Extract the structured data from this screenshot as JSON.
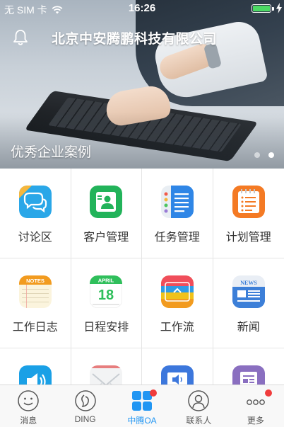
{
  "status_bar": {
    "carrier": "无 SIM 卡",
    "time": "16:26",
    "battery_level": 1.0
  },
  "header": {
    "company_name": "北京中安腾鹏科技有限公司",
    "bell_icon": "bell-icon"
  },
  "banner": {
    "caption": "优秀企业案例",
    "page_count": 2,
    "active_page": 2
  },
  "apps": [
    {
      "label": "讨论区",
      "icon": "chat-bubbles-icon",
      "color": "#2aa7e8"
    },
    {
      "label": "客户管理",
      "icon": "customer-card-icon",
      "color": "#22b35a"
    },
    {
      "label": "任务管理",
      "icon": "task-list-icon",
      "color": "#2f86e6"
    },
    {
      "label": "计划管理",
      "icon": "plan-notepad-icon",
      "color": "#f47a24"
    },
    {
      "label": "工作日志",
      "icon": "notes-icon",
      "color": "#f29b1f"
    },
    {
      "label": "日程安排",
      "icon": "calendar-icon",
      "color": "#2fbf5b"
    },
    {
      "label": "工作流",
      "icon": "workflow-icon",
      "color": "#f0c21a"
    },
    {
      "label": "新闻",
      "icon": "news-icon",
      "color": "#3c7fd8"
    },
    {
      "label": "",
      "icon": "announcement-speaker-icon",
      "color": "#1aa0e6"
    },
    {
      "label": "",
      "icon": "mail-envelope-icon",
      "color": "#cfd3d6"
    },
    {
      "label": "",
      "icon": "presentation-icon",
      "color": "#3c77dc"
    },
    {
      "label": "",
      "icon": "document-icon",
      "color": "#8a6fc0"
    }
  ],
  "icon_text": {
    "notes": "NOTES",
    "calendar_month": "APRIL",
    "calendar_day": "18",
    "news": "NEWS"
  },
  "tabs": [
    {
      "label": "消息",
      "icon": "smiley-chat-icon",
      "active": false,
      "badge": false
    },
    {
      "label": "DING",
      "icon": "ding-icon",
      "active": false,
      "badge": false
    },
    {
      "label": "中腾OA",
      "icon": "grid-apps-icon",
      "active": true,
      "badge": true
    },
    {
      "label": "联系人",
      "icon": "contact-person-icon",
      "active": false,
      "badge": false
    },
    {
      "label": "更多",
      "icon": "more-dots-icon",
      "active": false,
      "badge": true
    }
  ],
  "colors": {
    "accent": "#2196f3",
    "badge": "#f03c3c",
    "battery": "#4cd964"
  }
}
